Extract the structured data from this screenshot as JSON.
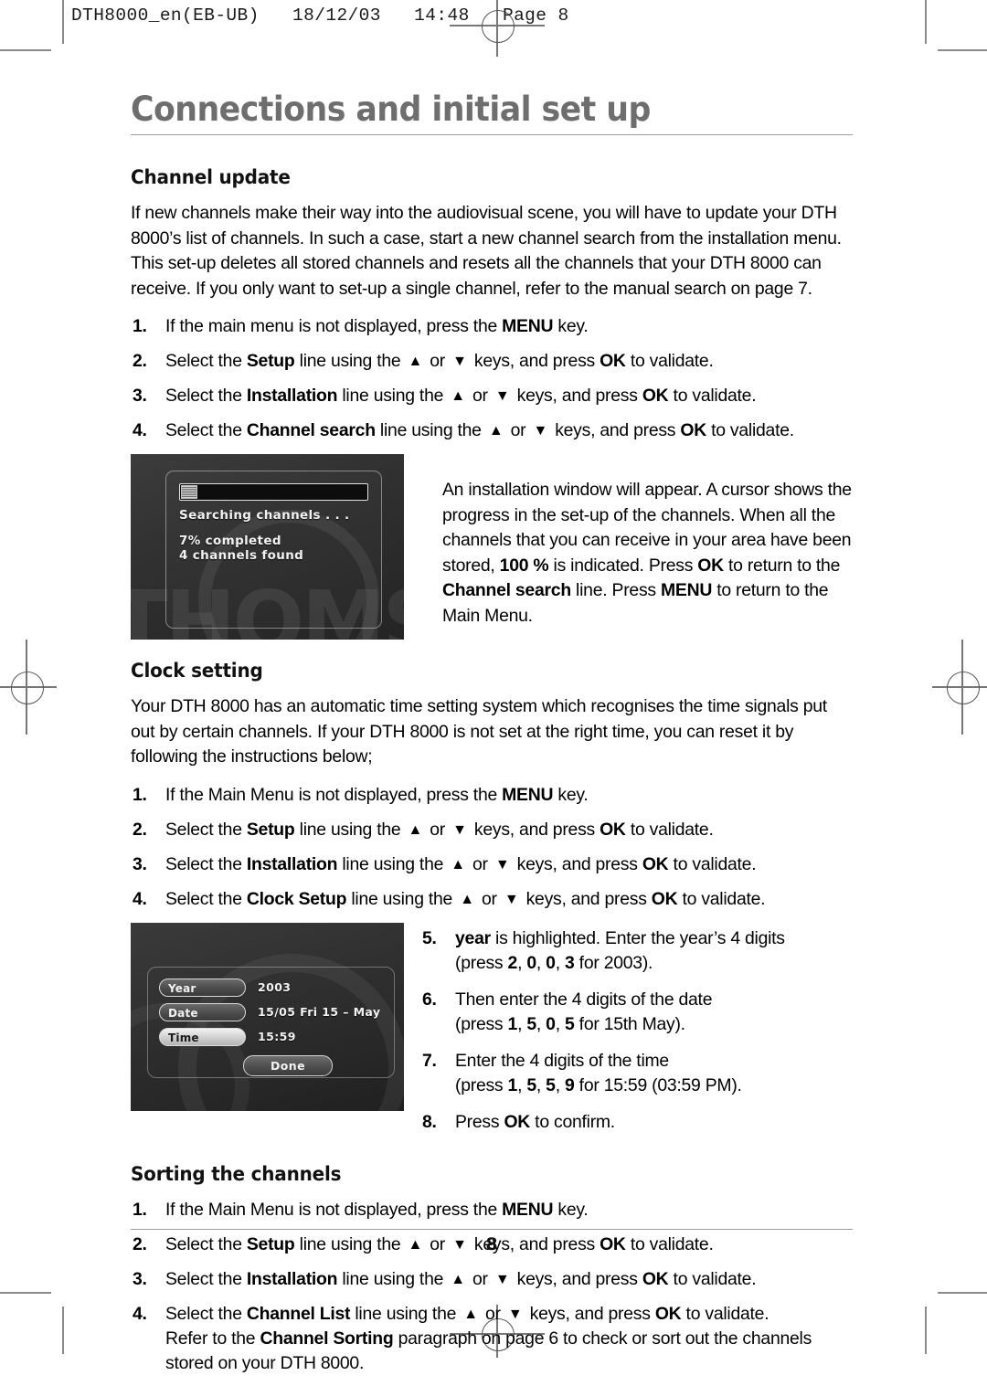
{
  "print_header": {
    "text": "DTH8000_en(EB-UB)   18/12/03   14:48   Page 8"
  },
  "chapter": {
    "title": "Connections and initial set up"
  },
  "footer": {
    "page_number": "8"
  },
  "sections": {
    "channel_update": {
      "heading": "Channel update",
      "intro": "If new channels make their way into the audiovisual scene, you will have to update your DTH 8000’s list of channels. In such a case, start a new channel search from the installation menu. This set-up deletes all stored channels and resets all the channels that your DTH 8000 can receive. If you only want to set-up a single channel, refer to the manual search on page 7.",
      "steps": [
        {
          "num": "1.",
          "html": "If the main menu is not displayed, press the <b>MENU</b> key."
        },
        {
          "num": "2.",
          "html": "Select the <b>Setup</b> line using the <span class=\"arrow\">▲</span> or <span class=\"arrow\">▼</span> keys, and press <b>OK</b> to validate."
        },
        {
          "num": "3.",
          "html": "Select the <b>Installation</b> line using the <span class=\"arrow\">▲</span> or <span class=\"arrow\">▼</span> keys, and press <b>OK</b> to validate."
        },
        {
          "num": "4.",
          "html": "Select the <b>Channel search</b> line using the <span class=\"arrow\">▲</span> or <span class=\"arrow\">▼</span> keys, and press <b>OK</b> to validate."
        }
      ],
      "figure_caption_html": "An installation window will appear. A cursor shows the progress in the set-up of the channels. When all the channels that you can receive in your area have been stored, <b>100 %</b> is indicated. Press <b>OK</b> to return to the <b>Channel search</b> line. Press <b>MENU</b> to return to the Main Menu."
    },
    "clock_setting": {
      "heading": "Clock setting",
      "intro": "Your DTH 8000 has an automatic time setting system which recognises the time signals put out by certain channels. If your DTH 8000 is not set at the right time, you can reset it by following the instructions below;",
      "steps": [
        {
          "num": "1.",
          "html": "If the Main Menu is not displayed, press the <b>MENU</b> key."
        },
        {
          "num": "2.",
          "html": "Select the <b>Setup</b> line using the <span class=\"arrow\">▲</span> or <span class=\"arrow\">▼</span> keys, and press <b>OK</b> to validate."
        },
        {
          "num": "3.",
          "html": "Select the <b>Installation</b> line using the <span class=\"arrow\">▲</span> or <span class=\"arrow\">▼</span> keys, and press <b>OK</b> to validate."
        },
        {
          "num": "4.",
          "html": "Select the <b>Clock Setup</b> line using the <span class=\"arrow\">▲</span> or <span class=\"arrow\">▼</span> keys, and press <b>OK</b> to validate."
        }
      ],
      "steps_right": [
        {
          "num": "5.",
          "html": "<b>year</b> is highlighted. Enter the year’s 4 digits<span class=\"sub\">(press <b>2</b>, <b>0</b>, <b>0</b>, <b>3</b> for 2003).</span>"
        },
        {
          "num": "6.",
          "html": "Then enter the 4 digits of the date<span class=\"sub\">(press <b>1</b>, <b>5</b>, <b>0</b>, <b>5</b> for 15th May).</span>"
        },
        {
          "num": "7.",
          "html": "Enter the 4 digits of the time<span class=\"sub\">(press <b>1</b>, <b>5</b>, <b>5</b>, <b>9</b> for 15:59 (03:59 PM).</span>"
        },
        {
          "num": "8.",
          "html": "Press <b>OK</b> to confirm."
        }
      ]
    },
    "sorting_channels": {
      "heading": "Sorting the channels",
      "steps": [
        {
          "num": "1.",
          "html": "If the Main Menu is not displayed, press the <b>MENU</b> key."
        },
        {
          "num": "2.",
          "html": "Select the <b>Setup</b> line using the <span class=\"arrow\">▲</span> or <span class=\"arrow\">▼</span> keys, and press <b>OK</b> to validate."
        },
        {
          "num": "3.",
          "html": "Select the <b>Installation</b> line using the <span class=\"arrow\">▲</span> or <span class=\"arrow\">▼</span> keys, and press <b>OK</b> to validate."
        },
        {
          "num": "4.",
          "html": "Select the <b>Channel List</b> line using the <span class=\"arrow\">▲</span> or <span class=\"arrow\">▼</span> keys, and press <b>OK</b> to validate.<br>Refer to the <b>Channel Sorting</b> paragraph on page 6 to check or sort out the channels stored on your DTH 8000."
        }
      ]
    }
  },
  "figures": {
    "channel_search_screen": {
      "watermark": "THOMSON",
      "progress_percent": 7,
      "searching_label": "Searching channels . . .",
      "completed_label": "7% completed",
      "found_label": "4 channels found"
    },
    "clock_setup_screen": {
      "rows": [
        {
          "label": "Year",
          "value": "2003",
          "highlighted": false
        },
        {
          "label": "Date",
          "value": "15/05  Fri   15 – May",
          "highlighted": false
        },
        {
          "label": "Time",
          "value": "15:59",
          "highlighted": true
        }
      ],
      "done_label": "Done"
    }
  }
}
